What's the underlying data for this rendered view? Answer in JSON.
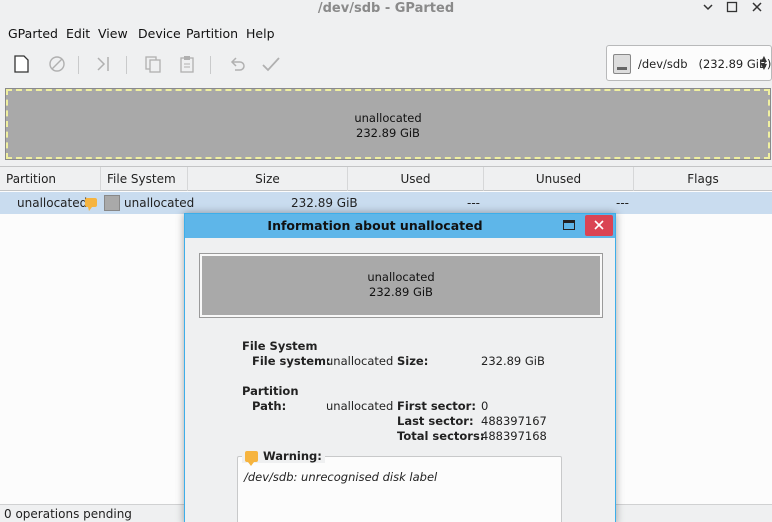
{
  "window": {
    "title": "/dev/sdb - GParted"
  },
  "menu": [
    {
      "label": "GParted",
      "name": "menu-gparted"
    },
    {
      "label": "Edit",
      "name": "menu-edit"
    },
    {
      "label": "View",
      "name": "menu-view"
    },
    {
      "label": "Device",
      "name": "menu-device"
    },
    {
      "label": "Partition",
      "name": "menu-partition"
    },
    {
      "label": "Help",
      "name": "menu-help"
    }
  ],
  "toolbar": {
    "icons": [
      "new-partition-icon",
      "delete-icon",
      "resize-move-icon",
      "copy-icon",
      "paste-icon",
      "undo-icon",
      "apply-icon"
    ]
  },
  "device_selector": {
    "device": "/dev/sdb",
    "size": "(232.89 GiB)"
  },
  "disk_map": {
    "label": "unallocated",
    "size": "232.89 GiB"
  },
  "table": {
    "headers": {
      "partition": "Partition",
      "file_system": "File System",
      "size": "Size",
      "used": "Used",
      "unused": "Unused",
      "flags": "Flags"
    },
    "row": {
      "partition": "unallocated",
      "file_system": "unallocated",
      "size": "232.89 GiB",
      "used": "---",
      "unused": "---",
      "flags": ""
    }
  },
  "status": {
    "text": "0 operations pending"
  },
  "dialog": {
    "title": "Information about unallocated",
    "map_label": "unallocated",
    "map_size": "232.89 GiB",
    "fs_section": "File System",
    "fs_label": "File system:",
    "fs_value": "unallocated",
    "size_label": "Size:",
    "size_value": "232.89 GiB",
    "partition_section": "Partition",
    "path_label": "Path:",
    "path_value": "unallocated",
    "first_sector_label": "First sector:",
    "first_sector_value": "0",
    "last_sector_label": "Last sector:",
    "last_sector_value": "488397167",
    "total_sectors_label": "Total sectors:",
    "total_sectors_value": "488397168",
    "warning_label": "Warning:",
    "warning_message": "/dev/sdb: unrecognised disk label"
  },
  "colors": {
    "unallocated": "#a9a9a9",
    "selection": "#c9dcef",
    "dialog_titlebar": "#5eb6e9",
    "close_button": "#da4453",
    "warning": "#f6b43f"
  }
}
